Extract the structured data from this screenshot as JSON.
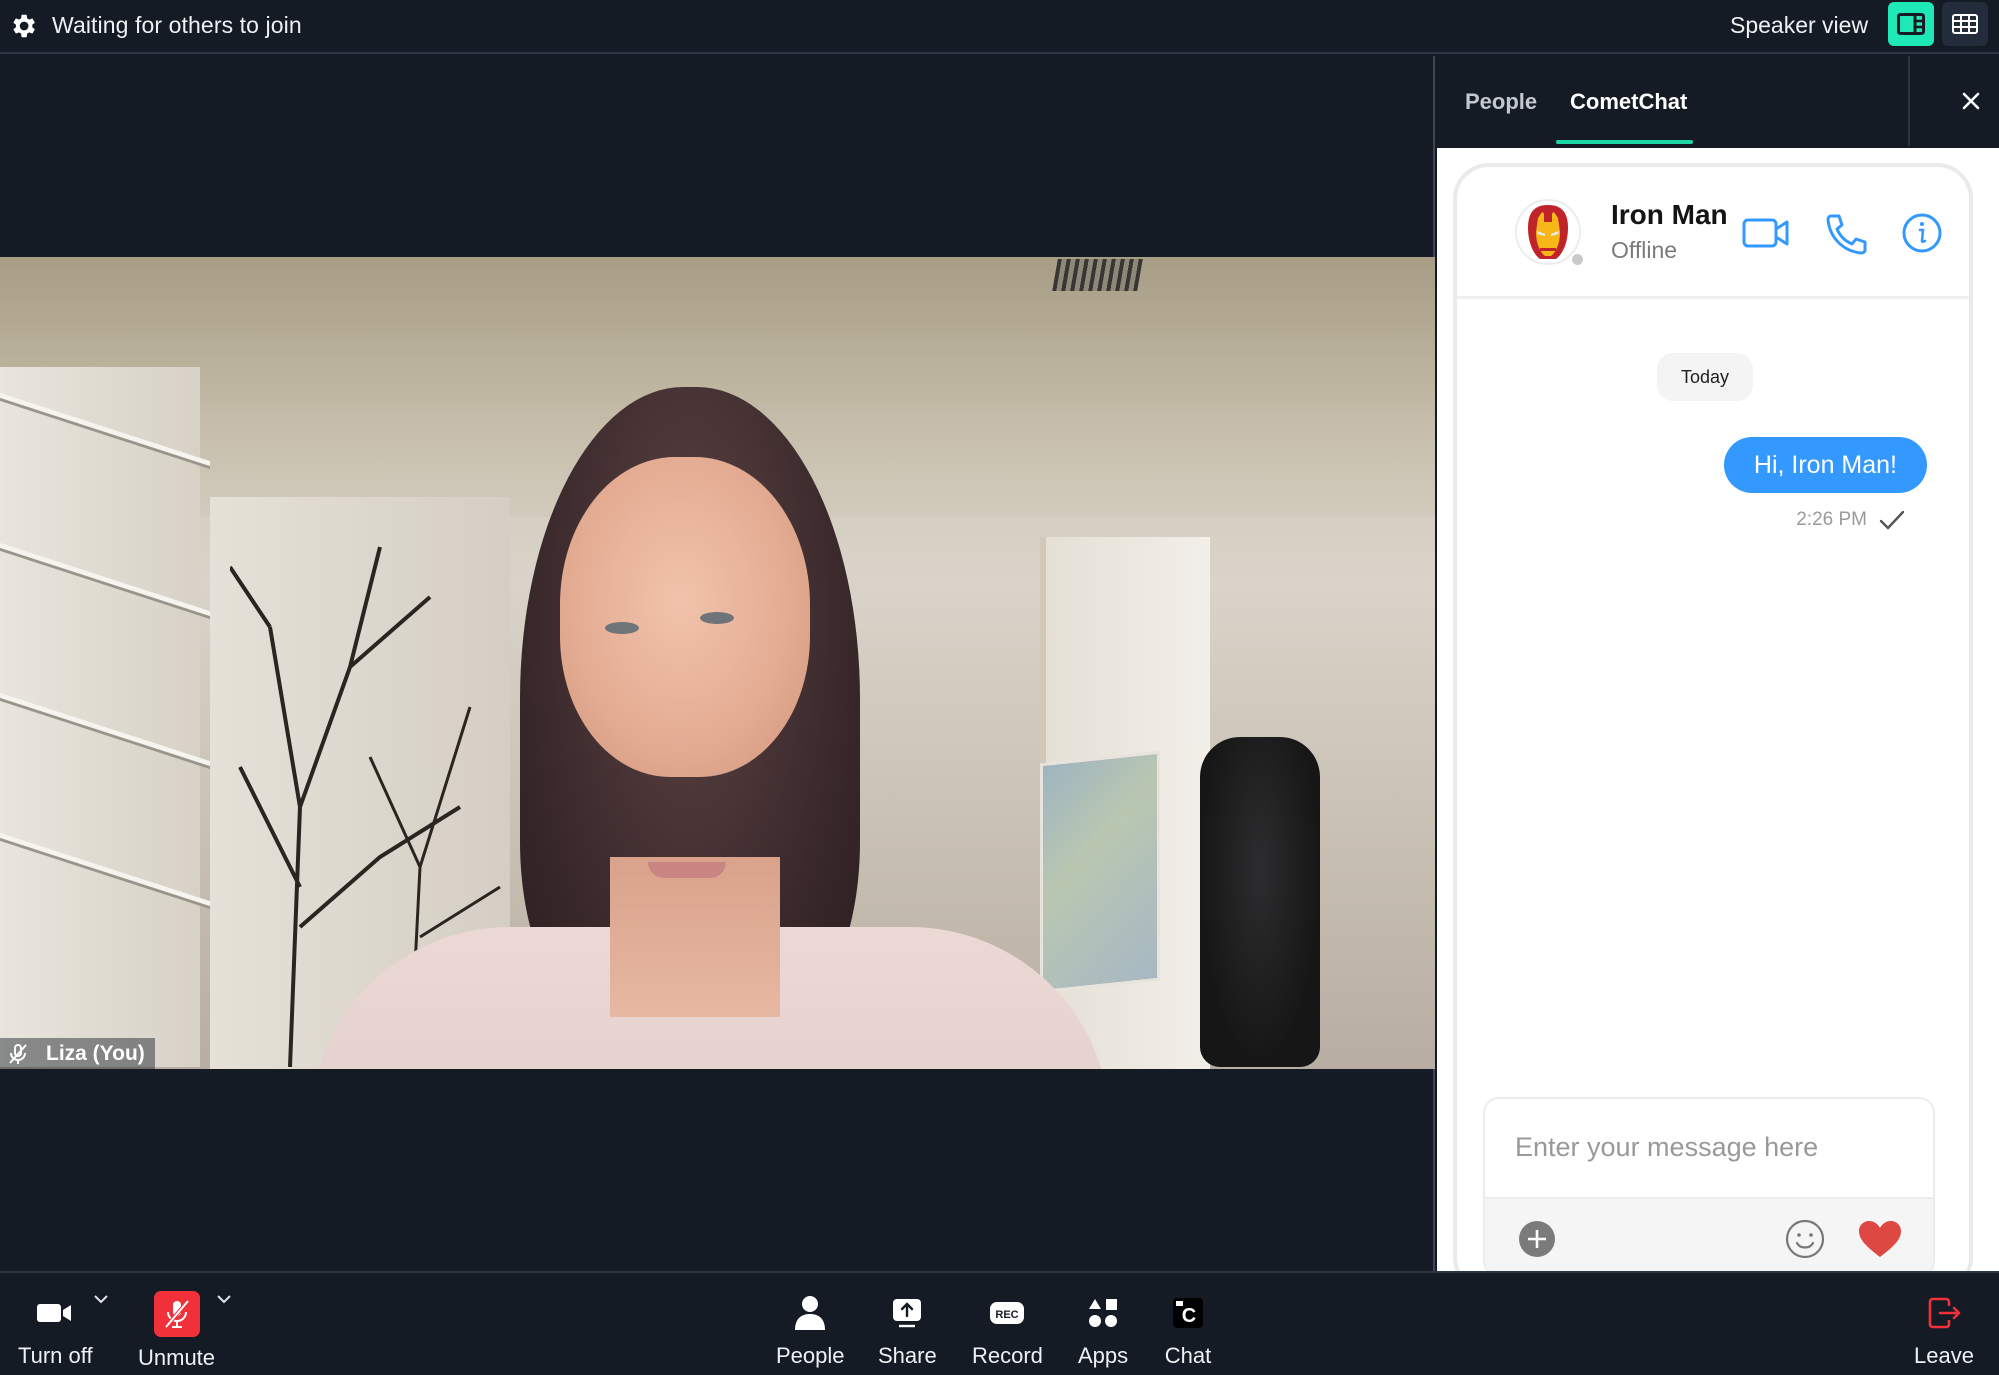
{
  "topbar": {
    "title": "Waiting for others to join",
    "speaker_view_label": "Speaker view",
    "icons": {
      "settings": "gear-icon",
      "speaker_view": "speaker-layout-icon",
      "grid_view": "grid-layout-icon"
    },
    "accent": "#1ee8b5"
  },
  "stage": {
    "participant_name": "Liza (You)",
    "muted": true
  },
  "panel": {
    "tabs": [
      {
        "label": "People",
        "active": false
      },
      {
        "label": "CometChat",
        "active": true
      }
    ],
    "close_icon": "close-icon",
    "chat": {
      "contact": {
        "name": "Iron Man",
        "status": "Offline",
        "avatar": "iron-man-avatar"
      },
      "header_actions": [
        "video-call-icon",
        "voice-call-icon",
        "info-icon"
      ],
      "date_separator": "Today",
      "messages": [
        {
          "text": "Hi, Iron Man!",
          "time": "2:26 PM",
          "outgoing": true,
          "status": "sent"
        }
      ],
      "composer": {
        "placeholder": "Enter your message here",
        "value": "",
        "actions": [
          "add-attachment-icon",
          "emoji-icon",
          "heart-reaction-icon"
        ]
      },
      "bubble_color": "#3399ff"
    }
  },
  "controls": {
    "left": [
      {
        "label": "Turn off",
        "icon": "camera-icon",
        "has_menu": true
      },
      {
        "label": "Unmute",
        "icon": "mic-muted-icon",
        "has_menu": true,
        "color": "#f0313a"
      }
    ],
    "center": [
      {
        "label": "People",
        "icon": "person-icon"
      },
      {
        "label": "Share",
        "icon": "share-screen-icon"
      },
      {
        "label": "Record",
        "icon": "record-icon",
        "badge": "REC"
      },
      {
        "label": "Apps",
        "icon": "apps-icon"
      },
      {
        "label": "Chat",
        "icon": "cometchat-icon",
        "badge": "C"
      }
    ],
    "right": [
      {
        "label": "Leave",
        "icon": "leave-icon",
        "color": "#f0313a"
      }
    ]
  }
}
